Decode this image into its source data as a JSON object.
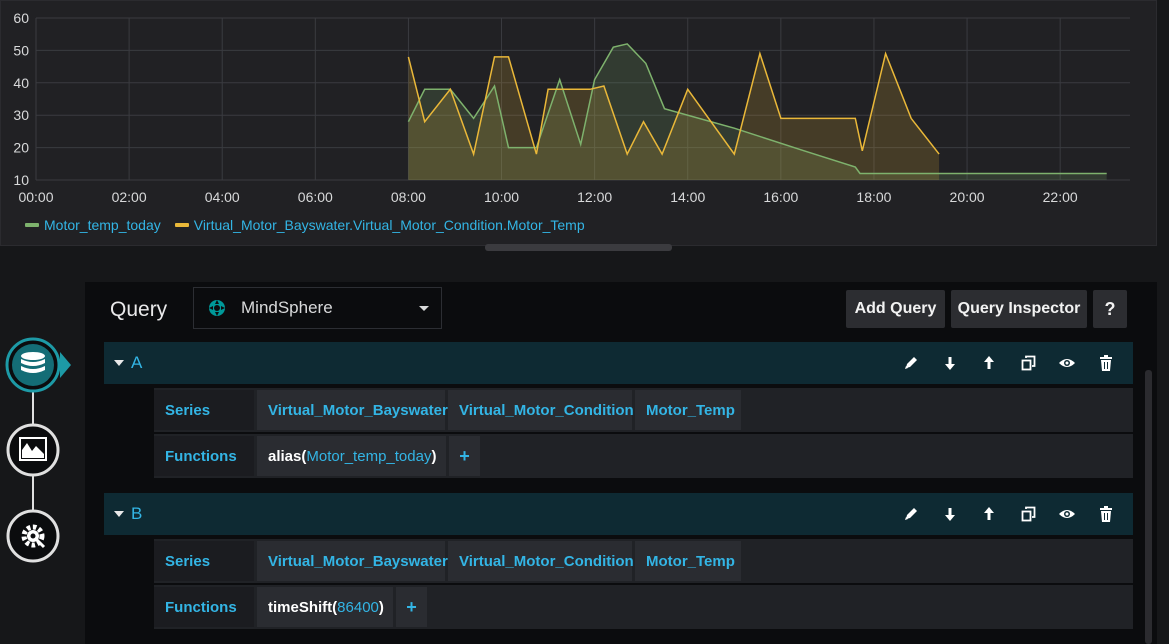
{
  "chart_data": {
    "type": "line",
    "x_ticks": [
      "00:00",
      "02:00",
      "04:00",
      "06:00",
      "08:00",
      "10:00",
      "12:00",
      "14:00",
      "16:00",
      "18:00",
      "20:00",
      "22:00"
    ],
    "y_ticks": [
      "10",
      "20",
      "30",
      "40",
      "50",
      "60"
    ],
    "xlim": [
      0,
      23.5
    ],
    "ylim": [
      10,
      60
    ],
    "grid": true,
    "legend_position": "bottom-left",
    "series": [
      {
        "name": "Motor_temp_today",
        "color": "#7eb26d",
        "x": [
          8.0,
          8.35,
          8.9,
          9.4,
          9.85,
          10.15,
          10.75,
          11.25,
          11.7,
          12.0,
          12.4,
          12.7,
          13.1,
          13.5,
          15.0,
          16.5,
          17.6,
          17.7,
          23.0
        ],
        "y": [
          28,
          38,
          38,
          29,
          39,
          20,
          20,
          41,
          21,
          41,
          51,
          52,
          46,
          32,
          26,
          19,
          14,
          12,
          12
        ]
      },
      {
        "name": "Virtual_Motor_Bayswater.Virtual_Motor_Condition.Motor_Temp",
        "color": "#eab839",
        "x": [
          8.0,
          8.35,
          8.9,
          9.4,
          9.85,
          10.15,
          10.75,
          11.0,
          11.3,
          11.9,
          12.2,
          12.7,
          13.05,
          13.45,
          14.0,
          14.5,
          15.0,
          15.55,
          16.0,
          16.55,
          17.6,
          17.75,
          18.25,
          18.8,
          19.4
        ],
        "y": [
          48,
          28,
          38,
          18,
          48,
          48,
          18,
          38,
          38,
          38,
          39,
          18,
          28,
          18,
          38,
          28,
          18,
          49,
          29,
          29,
          29,
          19,
          49,
          29,
          18
        ]
      }
    ]
  },
  "legend": {
    "series_a": "Motor_temp_today",
    "series_b": "Virtual_Motor_Bayswater.Virtual_Motor_Condition.Motor_Temp"
  },
  "query_editor": {
    "title": "Query",
    "datasource": "MindSphere",
    "add_query_label": "Add Query",
    "query_inspector_label": "Query Inspector",
    "help_label": "?"
  },
  "queries": [
    {
      "letter": "A",
      "series_label": "Series",
      "segments": [
        "Virtual_Motor_Bayswater",
        "Virtual_Motor_Condition",
        "Motor_Temp"
      ],
      "functions_label": "Functions",
      "function_name": "alias",
      "function_param": "Motor_temp_today",
      "add_label": "+"
    },
    {
      "letter": "B",
      "series_label": "Series",
      "segments": [
        "Virtual_Motor_Bayswater",
        "Virtual_Motor_Condition",
        "Motor_Temp"
      ],
      "functions_label": "Functions",
      "function_name": "timeShift",
      "function_param": "86400",
      "add_label": "+"
    }
  ],
  "colors": {
    "accent": "#33b5e5",
    "series_green": "#7eb26d",
    "series_yellow": "#eab839",
    "query_header": "#0e2a33"
  }
}
